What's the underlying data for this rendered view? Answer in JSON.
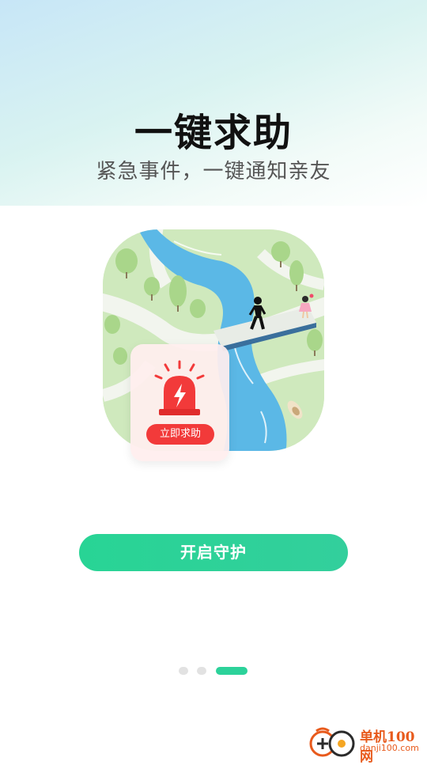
{
  "onboarding": {
    "title": "一键求助",
    "subtitle": "紧急事件，一键通知亲友",
    "sos_label": "立即求助",
    "primary_button": "开启守护",
    "page_indicator": {
      "total": 3,
      "active": 3
    }
  },
  "watermark": {
    "brand": "单机100网",
    "url": "danji100.com"
  },
  "colors": {
    "primary": "#2cd29a",
    "alert": "#f23a3a",
    "river": "#5bb8e6",
    "park": "#cfe9bd"
  },
  "icons": [
    "siren-icon",
    "walking-person-icon",
    "girl-figure-icon",
    "boat-icon",
    "dual-face-logo-icon"
  ]
}
